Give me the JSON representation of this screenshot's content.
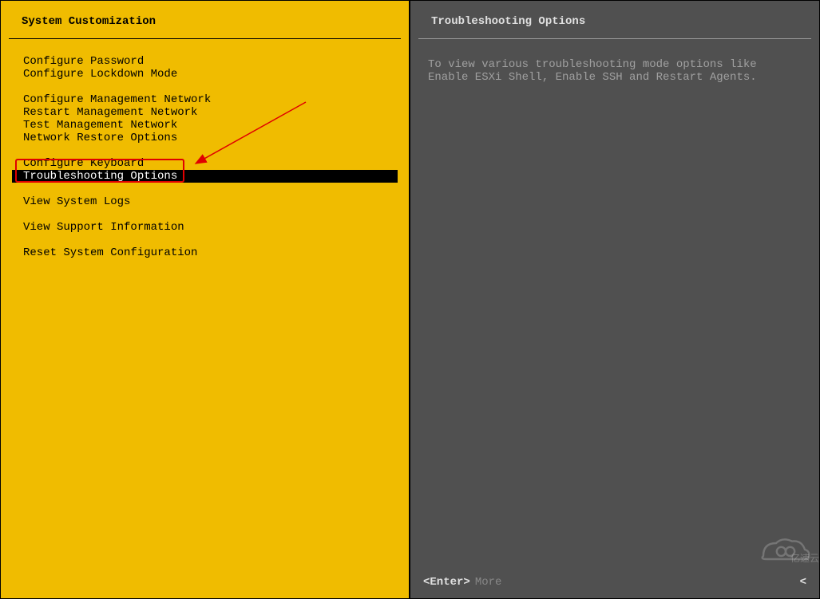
{
  "leftPanel": {
    "title": "System Customization",
    "menu": {
      "group1": [
        {
          "label": "Configure Password",
          "selected": false
        },
        {
          "label": "Configure Lockdown Mode",
          "selected": false
        }
      ],
      "group2": [
        {
          "label": "Configure Management Network",
          "selected": false
        },
        {
          "label": "Restart Management Network",
          "selected": false
        },
        {
          "label": "Test Management Network",
          "selected": false
        },
        {
          "label": "Network Restore Options",
          "selected": false
        }
      ],
      "group3": [
        {
          "label": "Configure Keyboard",
          "selected": false
        },
        {
          "label": "Troubleshooting Options",
          "selected": true
        }
      ],
      "group4": [
        {
          "label": "View System Logs",
          "selected": false
        }
      ],
      "group5": [
        {
          "label": "View Support Information",
          "selected": false
        }
      ],
      "group6": [
        {
          "label": "Reset System Configuration",
          "selected": false
        }
      ]
    }
  },
  "rightPanel": {
    "title": "Troubleshooting Options",
    "description": "To view various troubleshooting mode options like Enable ESXi Shell, Enable SSH and Restart Agents.",
    "footer": {
      "key": "<Enter>",
      "action": "More",
      "rightKey": "<"
    }
  },
  "watermark": {
    "text": "亿速云"
  }
}
